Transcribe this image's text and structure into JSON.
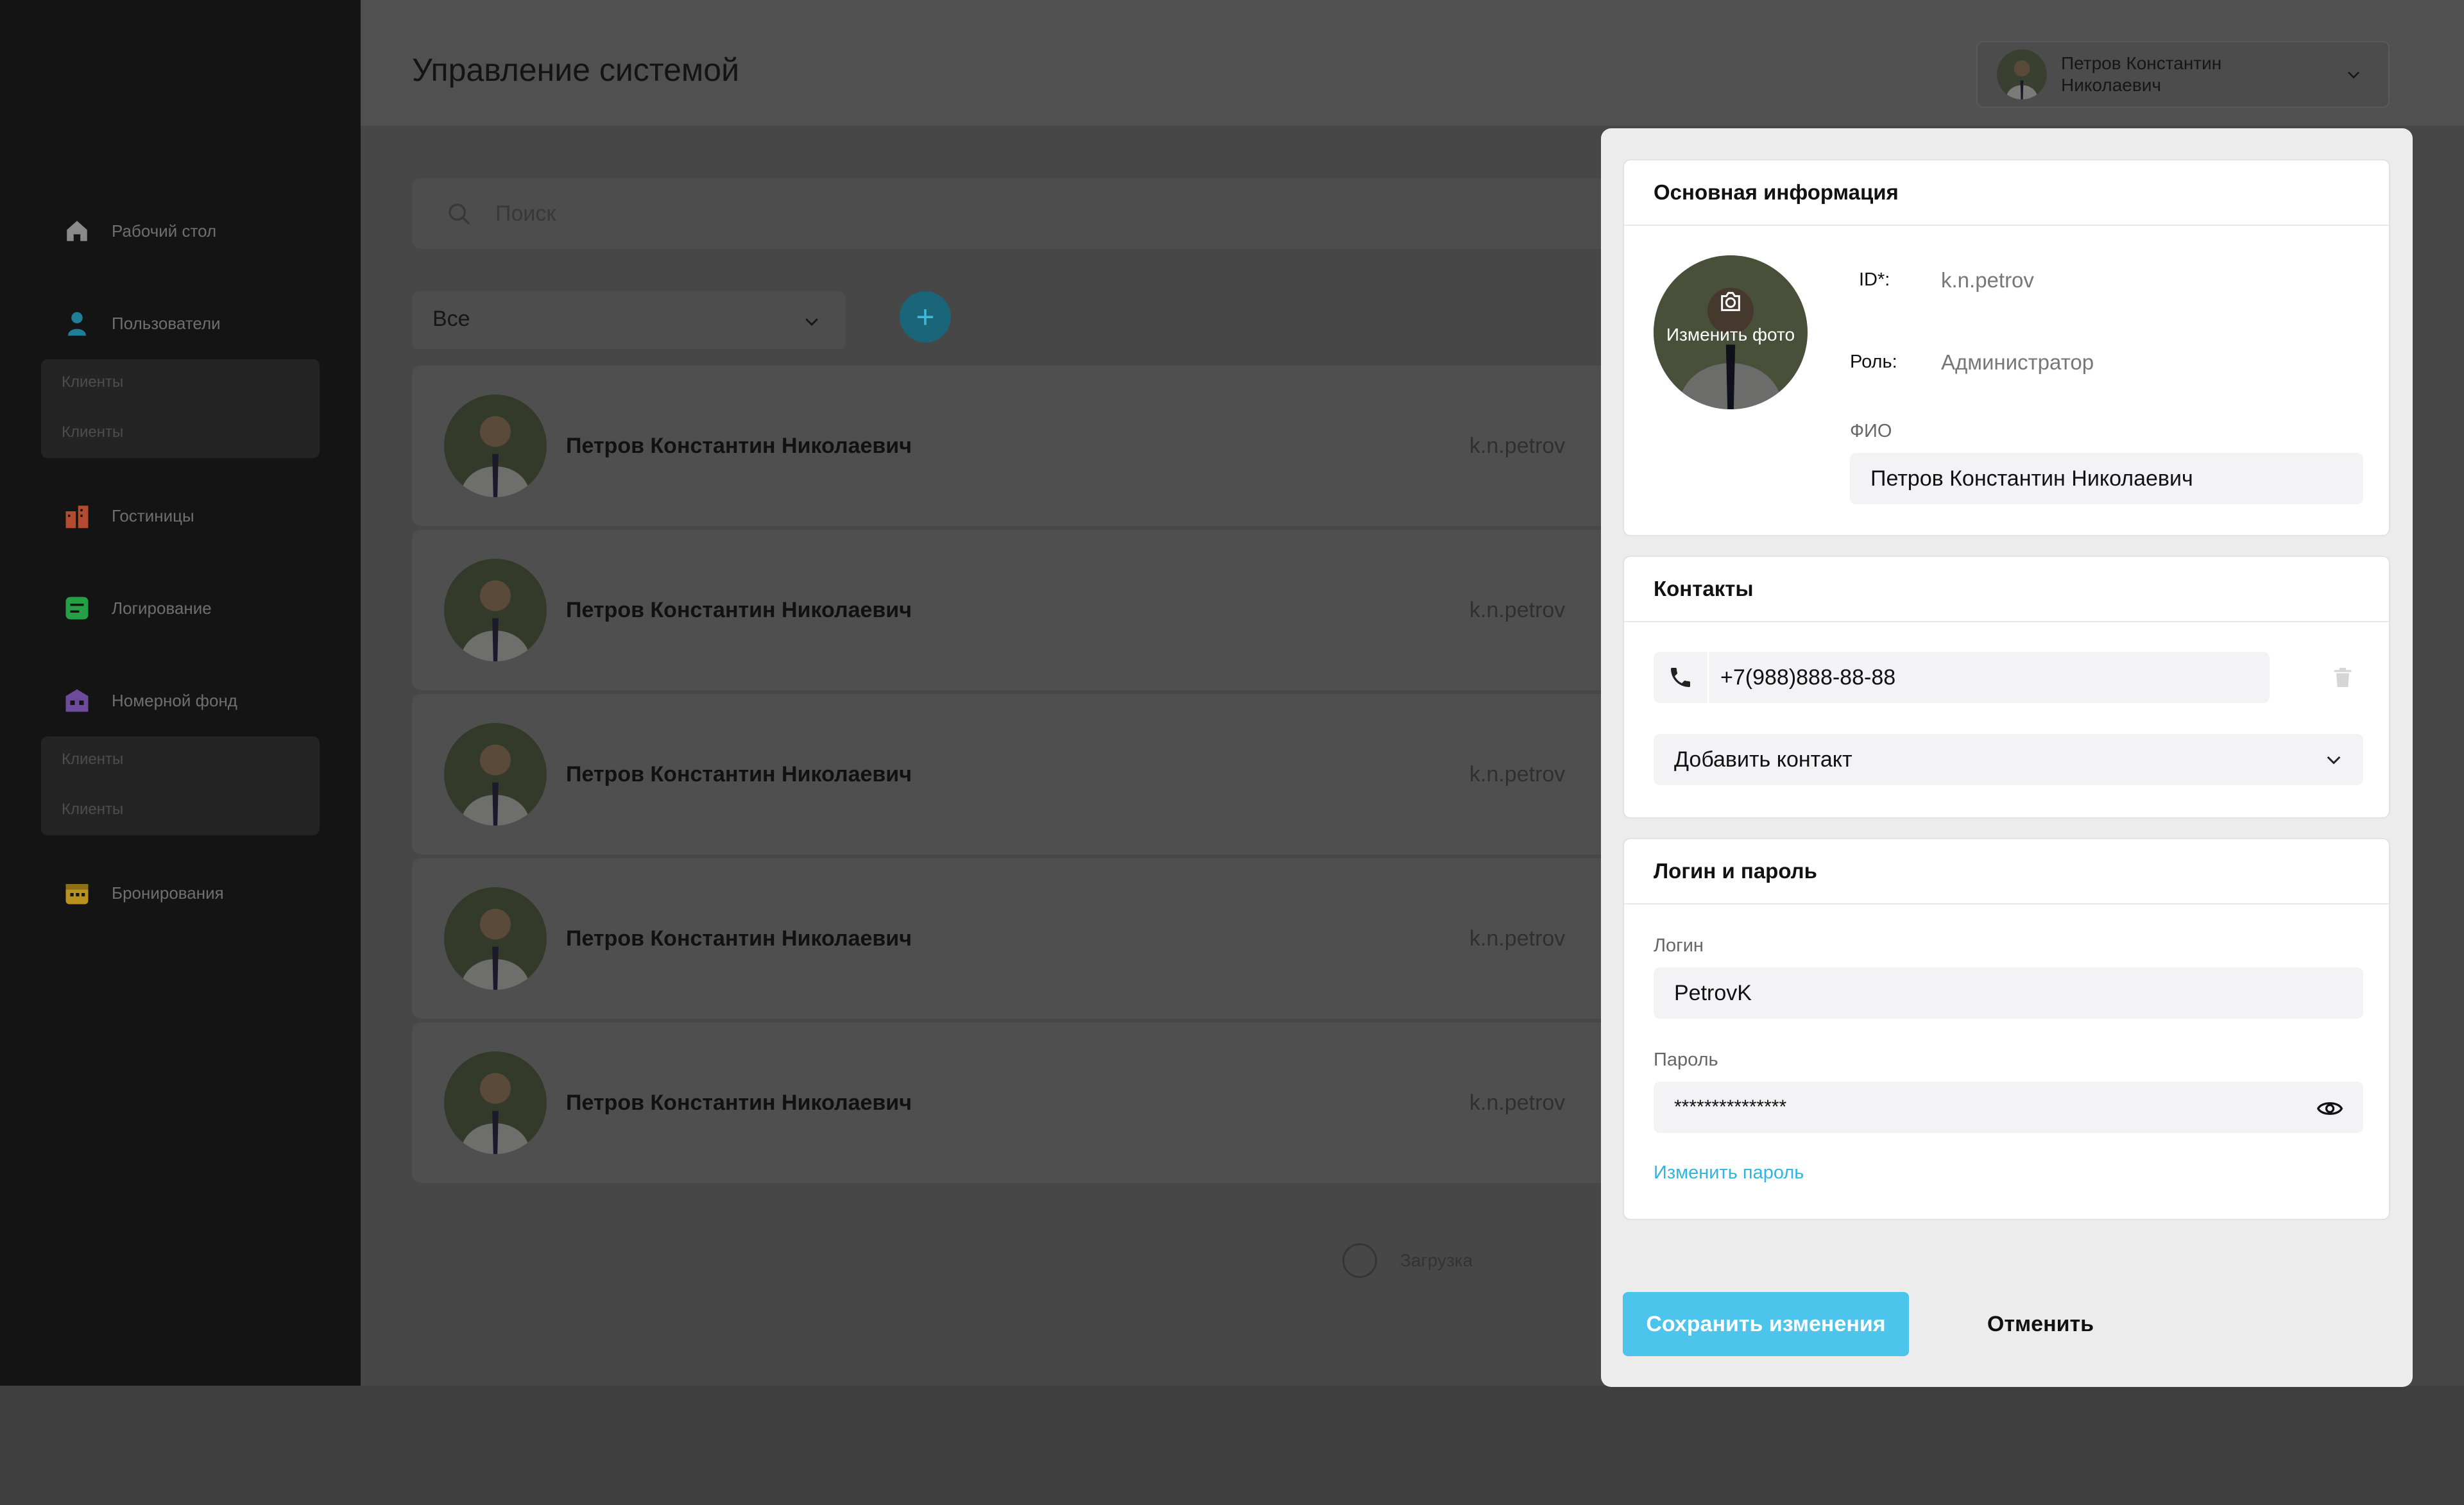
{
  "app": {
    "page_title": "Управление системой",
    "current_user": "Петров Константин Николаевич"
  },
  "sidebar": {
    "items": [
      {
        "label": "Рабочий стол",
        "icon": "home-icon",
        "color": "#8a8a8a"
      },
      {
        "label": "Пользователи",
        "icon": "user-icon",
        "color": "#1f7f98"
      },
      {
        "label": "Гостиницы",
        "icon": "hotel-icon",
        "color": "#b44a2f"
      },
      {
        "label": "Логирование",
        "icon": "log-icon",
        "color": "#26a046"
      },
      {
        "label": "Номерной фонд",
        "icon": "rooms-icon",
        "color": "#6d4a9b"
      },
      {
        "label": "Бронирования",
        "icon": "calendar-icon",
        "color": "#b8911f"
      }
    ],
    "users_sub": [
      "Клиенты",
      "Клиенты"
    ],
    "rooms_sub": [
      "Клиенты",
      "Клиенты"
    ]
  },
  "search": {
    "placeholder": "Поиск"
  },
  "filter": {
    "value": "Все"
  },
  "add_button": "+",
  "rows": [
    {
      "name": "Петров Константин Николаевич",
      "login": "k.n.petrov"
    },
    {
      "name": "Петров Константин Николаевич",
      "login": "k.n.petrov"
    },
    {
      "name": "Петров Константин Николаевич",
      "login": "k.n.petrov"
    },
    {
      "name": "Петров Константин Николаевич",
      "login": "k.n.petrov"
    },
    {
      "name": "Петров Константин Николаевич",
      "login": "k.n.petrov"
    }
  ],
  "loading": "Загрузка",
  "modal": {
    "basic": {
      "title": "Основная информация",
      "change_photo": "Изменить фото",
      "id_label": "ID*:",
      "id_value": "k.n.petrov",
      "role_label": "Роль:",
      "role_value": "Администратор",
      "fio_label": "ФИО",
      "fio_value": "Петров Константин Николаевич"
    },
    "contacts": {
      "title": "Контакты",
      "phone": "+7(988)888-88-88",
      "add_contact": "Добавить контакт"
    },
    "credentials": {
      "title": "Логин и пароль",
      "login_label": "Логин",
      "login_value": "PetrovK",
      "password_label": "Пароль",
      "password_value": "***************",
      "change_password": "Изменить пароль"
    },
    "save_label": "Сохранить изменения",
    "cancel_label": "Отменить"
  },
  "colors": {
    "accent": "#4cc4ec",
    "link": "#2cb6e3"
  }
}
